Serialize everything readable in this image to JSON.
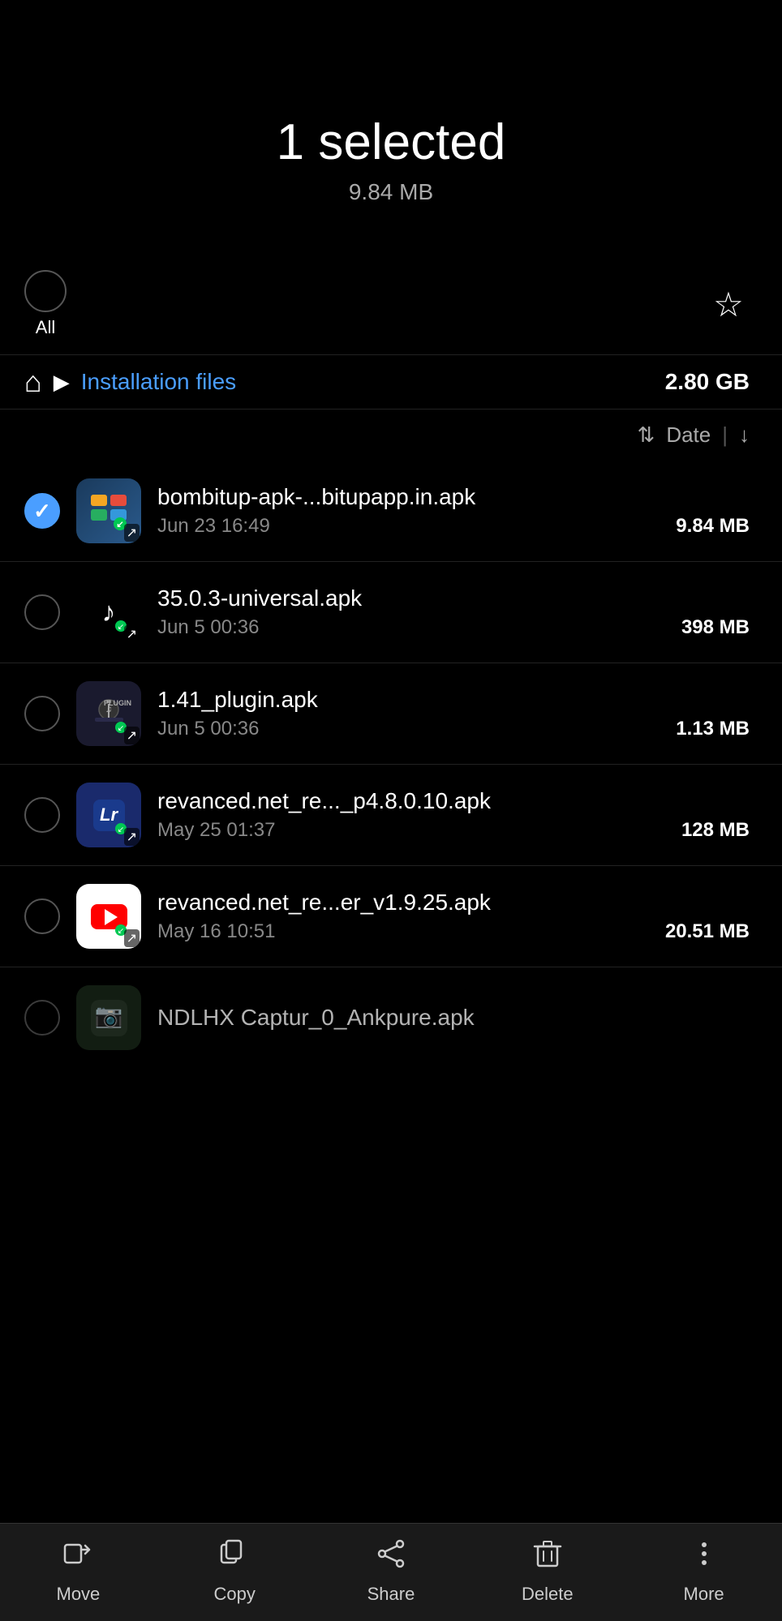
{
  "header": {
    "selected_count": "1 selected",
    "selected_size": "9.84 MB"
  },
  "controls": {
    "select_all_label": "All",
    "star_icon": "☆"
  },
  "breadcrumb": {
    "folder_size": "2.80 GB",
    "path_label": "Installation files"
  },
  "sort": {
    "label": "Date",
    "sort_icon": "⇅",
    "order_icon": "↓"
  },
  "files": [
    {
      "name": "bombitup-apk-...bitupapp.in.apk",
      "date": "Jun 23 16:49",
      "size": "9.84 MB",
      "checked": true,
      "icon_type": "bombitup",
      "icon_emoji": "💬"
    },
    {
      "name": "35.0.3-universal.apk",
      "date": "Jun 5 00:36",
      "size": "398 MB",
      "checked": false,
      "icon_type": "tiktok",
      "icon_emoji": "♪"
    },
    {
      "name": "1.41_plugin.apk",
      "date": "Jun 5 00:36",
      "size": "1.13 MB",
      "checked": false,
      "icon_type": "plugin",
      "icon_emoji": "🔌"
    },
    {
      "name": "revanced.net_re..._p4.8.0.10.apk",
      "date": "May 25 01:37",
      "size": "128 MB",
      "checked": false,
      "icon_type": "lightroom",
      "icon_emoji": "Lr"
    },
    {
      "name": "revanced.net_re...er_v1.9.25.apk",
      "date": "May 16 10:51",
      "size": "20.51 MB",
      "checked": false,
      "icon_type": "youtube",
      "icon_emoji": "▶"
    }
  ],
  "partial_file": {
    "name": "NDLHX Captur_0_Ankpure.apk",
    "checked": false
  },
  "bottom_nav": [
    {
      "label": "Move",
      "icon": "move"
    },
    {
      "label": "Copy",
      "icon": "copy"
    },
    {
      "label": "Share",
      "icon": "share"
    },
    {
      "label": "Delete",
      "icon": "delete"
    },
    {
      "label": "More",
      "icon": "more"
    }
  ]
}
